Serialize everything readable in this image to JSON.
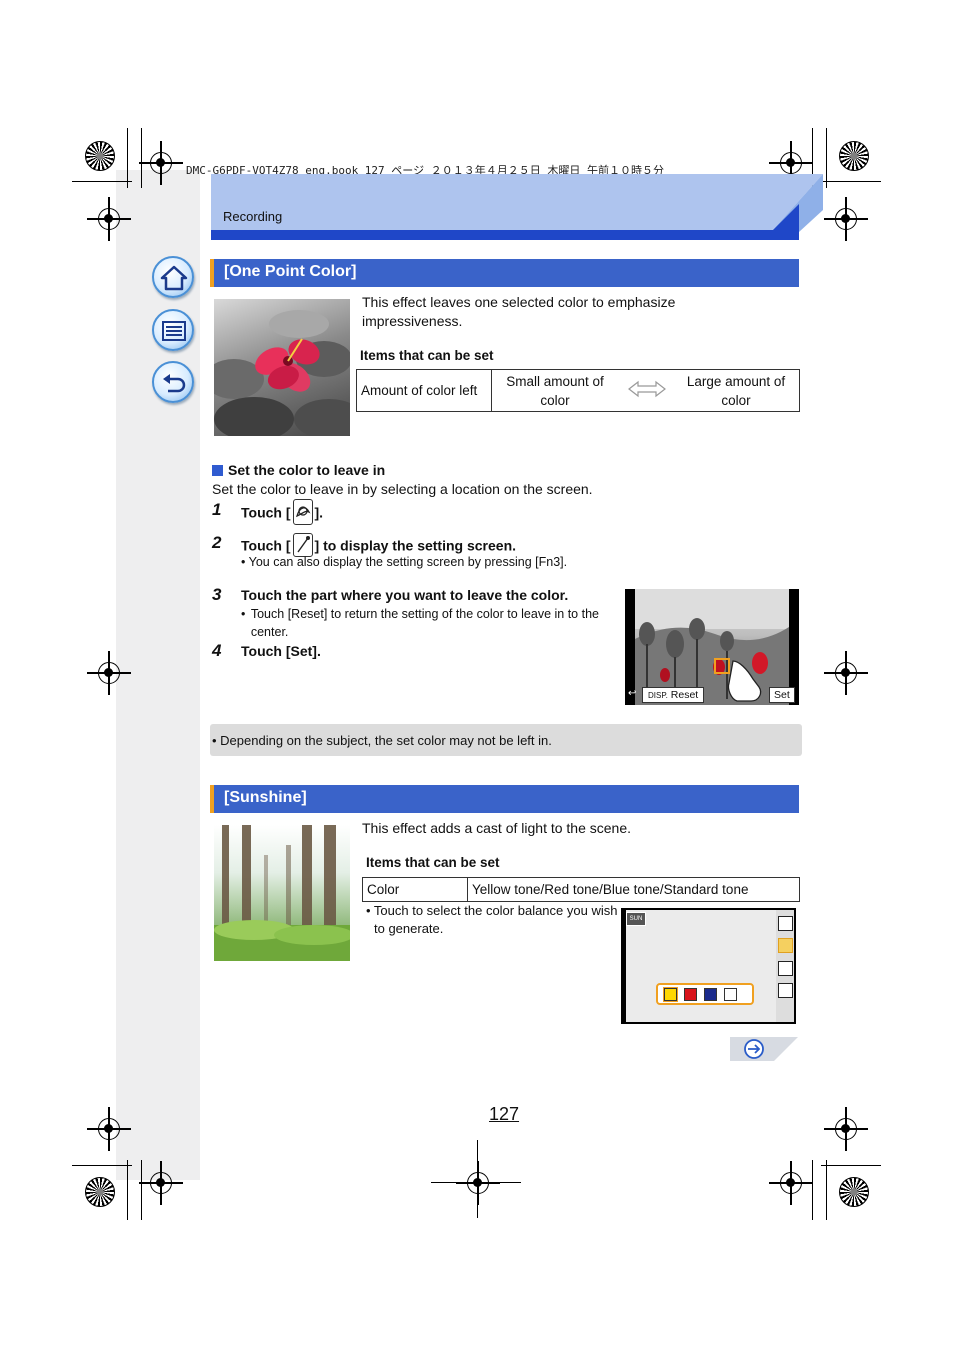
{
  "print_line": "DMC-G6PDF-VQT4Z78_eng.book  127 ページ  ２０１３年４月２５日  木曜日  午前１０時５分",
  "header": {
    "title": "Recording"
  },
  "section1": {
    "title": "[One Point Color]",
    "description": "This effect leaves one selected color to emphasize impressiveness.",
    "items_heading": "Items that can be set",
    "table": {
      "label": "Amount of color left",
      "low": "Small amount of color",
      "high": "Large amount of color"
    }
  },
  "set_color": {
    "heading": "Set the color to leave in",
    "text": "Set the color to leave in by selecting a location on the screen.",
    "steps": [
      {
        "num": "1",
        "pre": "Touch [",
        "post": "]."
      },
      {
        "num": "2",
        "pre": "Touch [",
        "post": "] to display the setting screen.",
        "note": "You can also display the setting screen by pressing [Fn3]."
      },
      {
        "num": "3",
        "text": "Touch the part where you want to leave the color.",
        "note": "Touch [Reset] to return the setting of the color to leave in to the center."
      },
      {
        "num": "4",
        "text": "Touch [Set]."
      }
    ],
    "screen": {
      "disp": "DISP.",
      "reset": "Reset",
      "set": "Set"
    }
  },
  "note": "• Depending on the subject, the set color may not be left in.",
  "section2": {
    "title": "[Sunshine]",
    "description": "This effect adds a cast of light to the scene.",
    "items_heading": "Items that can be set",
    "table": {
      "label": "Color",
      "value": "Yellow tone/Red tone/Blue tone/Standard tone"
    },
    "bullet": "• Touch to select the color balance you wish to generate.",
    "screen": {
      "badge": "SUN",
      "swatches": [
        "#ffd800",
        "#d8141c",
        "#1a2a8c",
        "#ffffff"
      ]
    }
  },
  "page_number": "127",
  "colors": {
    "accent": "#3a63c9",
    "header_band": "#aec4ee",
    "header_dark": "#1f47c8",
    "note_bg": "#dcdcdc",
    "highlight": "#f0a020"
  }
}
